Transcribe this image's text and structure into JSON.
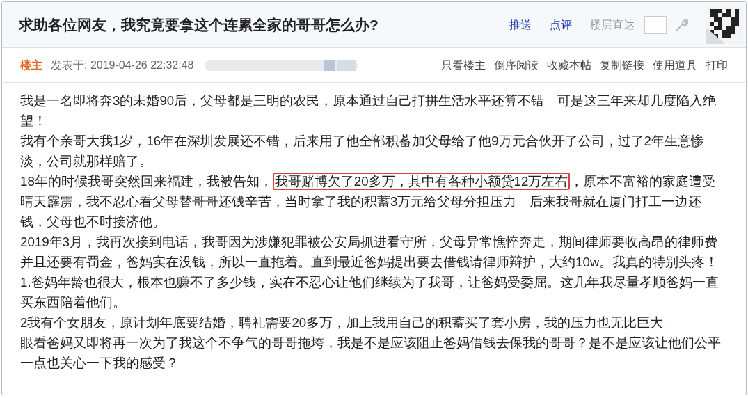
{
  "thread": {
    "title": "求助各位网友，我究竟要拿这个连累全家的哥哥怎么办?",
    "actions": [
      {
        "label": "推送",
        "kind": "link"
      },
      {
        "label": "点评",
        "kind": "link"
      },
      {
        "label": "楼层直达",
        "kind": "muted"
      }
    ],
    "floor_input": {
      "kind": "field"
    }
  },
  "post": {
    "author_tag": "楼主",
    "posted": "发表于: 2019-04-26 22:32:48",
    "author_redacted": true,
    "tools": [
      "只看楼主",
      "倒序阅读",
      "收藏本帖",
      "复制链接",
      "使用道具",
      "打印"
    ],
    "paragraphs": [
      {
        "segments": [
          {
            "text": "我是一名即将奔3的未婚90后，父母都是三明的农民，原本通过自己打拼生活水平还算不错。可是这三年来却几度陷入绝望！",
            "highlighted": false
          }
        ]
      },
      {
        "segments": [
          {
            "text": "我有个亲哥大我1岁，16年在深圳发展还不错，后来用了他全部积蓄加父母给了他9万元合伙开了公司，过了2年生意惨淡，公司就那样赔了。",
            "highlighted": false
          }
        ]
      },
      {
        "segments": [
          {
            "text": "18年的时候我哥突然回来福建，我被告知，",
            "highlighted": false
          },
          {
            "text": "我哥赌博欠了20多万，其中有各种小额贷12万左右",
            "highlighted": true
          },
          {
            "text": "，原本不富裕的家庭遭受晴天霹雳，我不忍心看父母替哥哥还钱辛苦，当时拿了我的积蓄3万元给父母分担压力。后来我哥就在厦门打工一边还钱，父母也不时接济他。",
            "highlighted": false
          }
        ]
      },
      {
        "segments": [
          {
            "text": "2019年3月，我再次接到电话，我哥因为涉嫌犯罪被公安局抓进看守所，父母异常憔悴奔走，期间律师要收高昂的律师费并且还要有罚金，爸妈实在没钱，所以一直拖着。直到最近爸妈提出要去借钱请律师辩护，大约10w。我真的特别头疼！",
            "highlighted": false
          }
        ]
      },
      {
        "segments": [
          {
            "text": "1.爸妈年龄也很大，根本也赚不了多少钱，实在不忍心让他们继续为了我哥，让爸妈受委屈。这几年我尽量孝顺爸妈一直买东西陪着他们。",
            "highlighted": false
          }
        ]
      },
      {
        "segments": [
          {
            "text": "2我有个女朋友，原计划年底要结婚，聘礼需要20多万，加上我用自己的积蓄买了套小房，我的压力也无比巨大。",
            "highlighted": false
          }
        ]
      },
      {
        "segments": [
          {
            "text": "眼看爸妈又即将再一次为了我这个不争气的哥哥拖垮，我是不是应该阻止爸妈借钱去保我的哥哥？是不是应该让他们公平一点也关心一下我的感受？",
            "highlighted": false
          }
        ]
      }
    ]
  }
}
